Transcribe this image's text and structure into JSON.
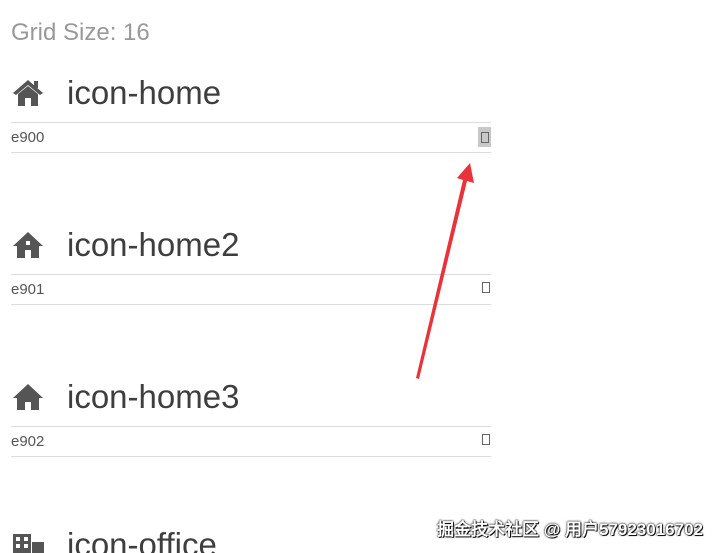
{
  "header": {
    "grid_size_text": "Grid Size: 16"
  },
  "glyphs": [
    {
      "name": "icon-home",
      "code": "e900",
      "icon": "home-icon",
      "selected": true
    },
    {
      "name": "icon-home2",
      "code": "e901",
      "icon": "home2-icon",
      "selected": false
    },
    {
      "name": "icon-home3",
      "code": "e902",
      "icon": "home3-icon",
      "selected": false
    },
    {
      "name": "icon-office",
      "icon": "office-icon"
    }
  ],
  "annotation": {
    "arrow_color": "#e8333a"
  },
  "watermark": {
    "text": "掘金技术社区 @ 用户57923016702"
  },
  "colors": {
    "icon": "#555555",
    "text": "#3e3e3e",
    "muted": "#999999"
  }
}
